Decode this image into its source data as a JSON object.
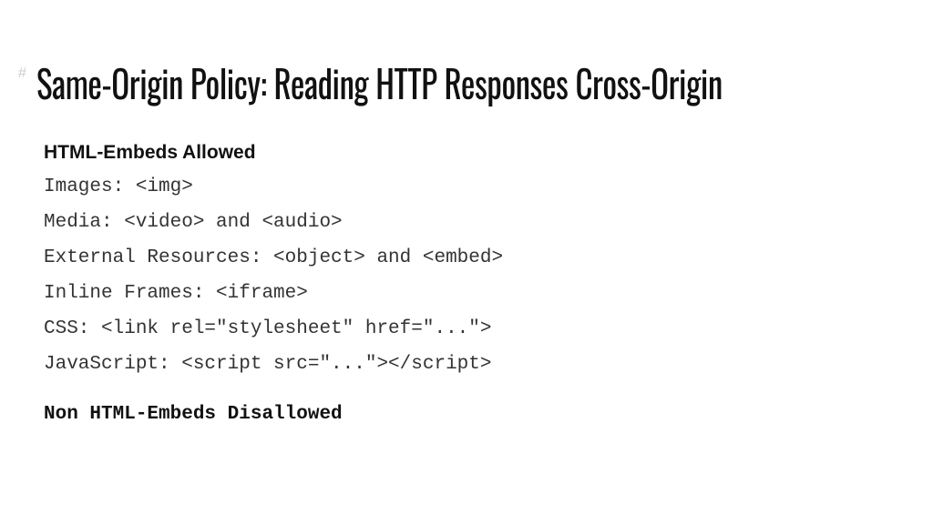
{
  "hash": "#",
  "title": "Same-Origin Policy: Reading HTTP Responses Cross-Origin",
  "section1_heading": "HTML-Embeds Allowed",
  "lines": [
    "Images: <img>",
    "Media: <video> and <audio>",
    "External Resources: <object> and <embed>",
    "Inline Frames: <iframe>",
    "CSS: <link rel=\"stylesheet\" href=\"...\">",
    "JavaScript: <script src=\"...\"></script>"
  ],
  "section2_heading": "Non HTML-Embeds Disallowed"
}
